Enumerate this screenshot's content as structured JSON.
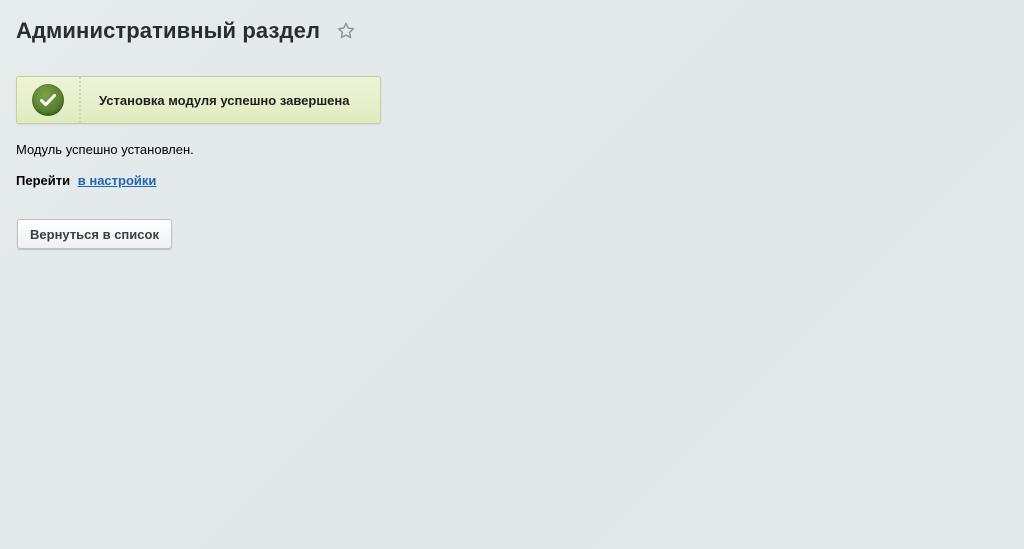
{
  "header": {
    "title": "Административный раздел",
    "star_icon": "star-outline-icon"
  },
  "notice": {
    "icon": "checkmark-circle-icon",
    "message": "Установка модуля успешно завершена",
    "accent_color": "#5b8230"
  },
  "content": {
    "status_text": "Модуль успешно установлен.",
    "goto_label": "Перейти",
    "settings_link": "в настройки"
  },
  "actions": {
    "back_button": "Вернуться в список"
  },
  "colors": {
    "background": "#e2e8ea",
    "link": "#2067b0",
    "notice_bg": "#e6efca"
  }
}
